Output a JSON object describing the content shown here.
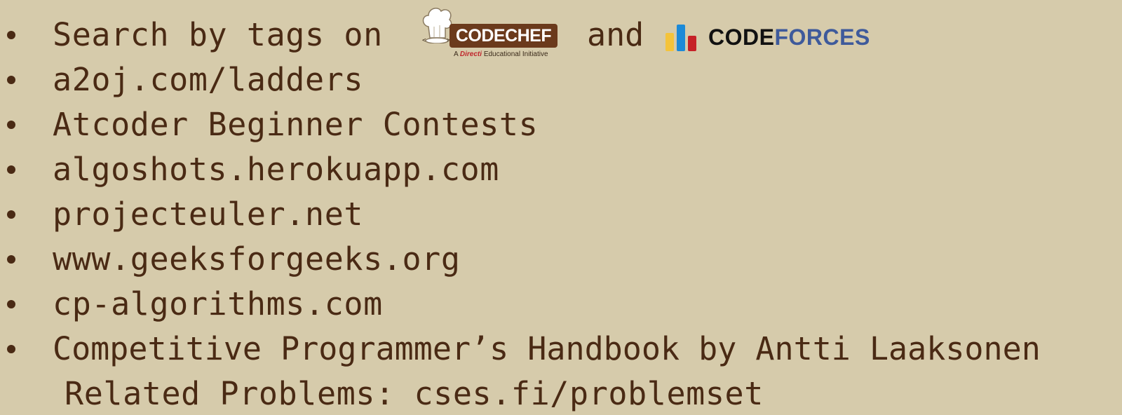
{
  "items": [
    {
      "text": "Search by tags on"
    },
    {
      "text": "a2oj.com/ladders"
    },
    {
      "text": "Atcoder Beginner Contests"
    },
    {
      "text": "algoshots.herokuapp.com"
    },
    {
      "text": "projecteuler.net"
    },
    {
      "text": "www.geeksforgeeks.org"
    },
    {
      "text": "cp-algorithms.com"
    },
    {
      "text": "Competitive Programmer’s Handbook by Antti Laaksonen"
    }
  ],
  "continuation": "Related Problems: cses.fi/problemset",
  "and_text": "and",
  "codechef": {
    "name": "CODECHEF",
    "subtitle_prefix": "A",
    "subtitle_brand": "Directi",
    "subtitle_suffix": "Educational Initiative"
  },
  "codeforces": {
    "code": "CODE",
    "forces": "FORCES"
  },
  "colors": {
    "background": "#d6cbab",
    "text": "#4a2a14",
    "codechef_brown": "#6b3a1c",
    "codeforces_blue": "#3e5a9b",
    "cf_bar_yellow": "#f4c33b",
    "cf_bar_blue": "#1c8ad8",
    "cf_bar_red": "#c62127"
  }
}
